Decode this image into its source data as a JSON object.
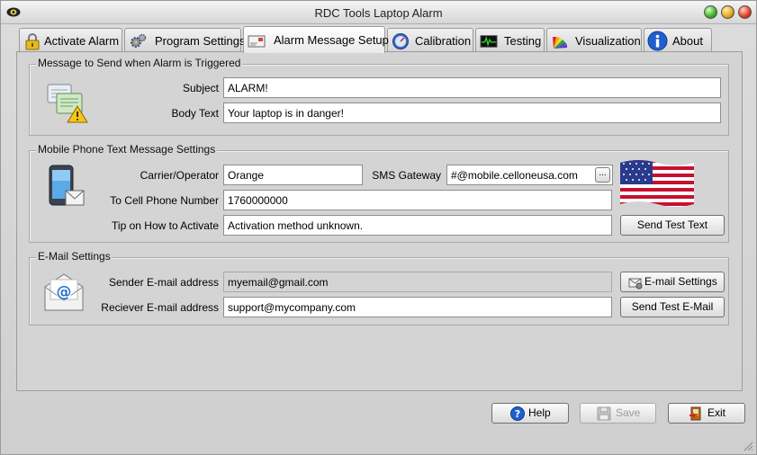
{
  "window": {
    "title": "RDC Tools Laptop Alarm"
  },
  "tabs": [
    {
      "label": "Activate Alarm",
      "icon": "padlock-icon"
    },
    {
      "label": "Program Settings",
      "icon": "gears-icon"
    },
    {
      "label": "Alarm Message Setup",
      "icon": "envelope-icon",
      "active": true
    },
    {
      "label": "Calibration",
      "icon": "gauge-icon"
    },
    {
      "label": "Testing",
      "icon": "monitor-graph-icon"
    },
    {
      "label": "Visualization",
      "icon": "color-fan-icon"
    },
    {
      "label": "About",
      "icon": "info-icon"
    }
  ],
  "message": {
    "group_title": "Message to Send when Alarm is Triggered",
    "subject_label": "Subject",
    "subject_value": "ALARM!",
    "body_label": "Body Text",
    "body_value": "Your laptop is in danger!"
  },
  "mobile": {
    "group_title": "Mobile Phone Text Message Settings",
    "carrier_label": "Carrier/Operator",
    "carrier_value": "Orange",
    "gateway_label": "SMS Gateway",
    "gateway_value": "#@mobile.celloneusa.com",
    "gateway_browse": "...",
    "number_label": "To Cell Phone Number",
    "number_value": "1760000000",
    "tip_label": "Tip on How to Activate",
    "tip_value": "Activation method unknown.",
    "send_test_text": "Send Test Text"
  },
  "email": {
    "group_title": "E-Mail Settings",
    "sender_label": "Sender E-mail address",
    "sender_value": "myemail@gmail.com",
    "receiver_label": "Reciever E-mail address",
    "receiver_value": "support@mycompany.com",
    "settings_button": "E-mail Settings",
    "send_test_email": "Send Test E-Mail"
  },
  "footer": {
    "help": "Help",
    "save": "Save",
    "exit": "Exit"
  }
}
